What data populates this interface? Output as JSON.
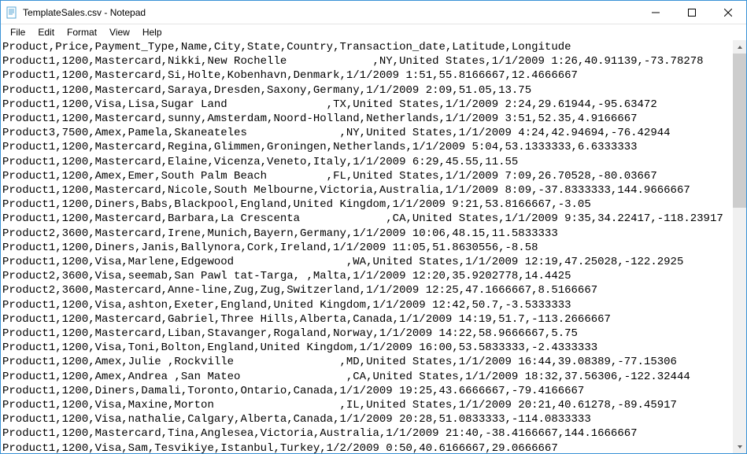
{
  "window": {
    "title": "TemplateSales.csv - Notepad"
  },
  "menu": {
    "file": "File",
    "edit": "Edit",
    "format": "Format",
    "view": "View",
    "help": "Help"
  },
  "content_lines": [
    "Product,Price,Payment_Type,Name,City,State,Country,Transaction_date,Latitude,Longitude",
    "Product1,1200,Mastercard,Nikki,New Rochelle             ,NY,United States,1/1/2009 1:26,40.91139,-73.78278",
    "Product1,1200,Mastercard,Si,Holte,Kobenhavn,Denmark,1/1/2009 1:51,55.8166667,12.4666667",
    "Product1,1200,Mastercard,Saraya,Dresden,Saxony,Germany,1/1/2009 2:09,51.05,13.75",
    "Product1,1200,Visa,Lisa,Sugar Land               ,TX,United States,1/1/2009 2:24,29.61944,-95.63472",
    "Product1,1200,Mastercard,sunny,Amsterdam,Noord-Holland,Netherlands,1/1/2009 3:51,52.35,4.9166667",
    "Product3,7500,Amex,Pamela,Skaneateles              ,NY,United States,1/1/2009 4:24,42.94694,-76.42944",
    "Product1,1200,Mastercard,Regina,Glimmen,Groningen,Netherlands,1/1/2009 5:04,53.1333333,6.6333333",
    "Product1,1200,Mastercard,Elaine,Vicenza,Veneto,Italy,1/1/2009 6:29,45.55,11.55",
    "Product1,1200,Amex,Emer,South Palm Beach         ,FL,United States,1/1/2009 7:09,26.70528,-80.03667",
    "Product1,1200,Mastercard,Nicole,South Melbourne,Victoria,Australia,1/1/2009 8:09,-37.8333333,144.9666667",
    "Product1,1200,Diners,Babs,Blackpool,England,United Kingdom,1/1/2009 9:21,53.8166667,-3.05",
    "Product1,1200,Mastercard,Barbara,La Crescenta             ,CA,United States,1/1/2009 9:35,34.22417,-118.23917",
    "Product2,3600,Mastercard,Irene,Munich,Bayern,Germany,1/1/2009 10:06,48.15,11.5833333",
    "Product1,1200,Diners,Janis,Ballynora,Cork,Ireland,1/1/2009 11:05,51.8630556,-8.58",
    "Product1,1200,Visa,Marlene,Edgewood                 ,WA,United States,1/1/2009 12:19,47.25028,-122.2925",
    "Product2,3600,Visa,seemab,San Pawl tat-Targa, ,Malta,1/1/2009 12:20,35.9202778,14.4425",
    "Product2,3600,Mastercard,Anne-line,Zug,Zug,Switzerland,1/1/2009 12:25,47.1666667,8.5166667",
    "Product1,1200,Visa,ashton,Exeter,England,United Kingdom,1/1/2009 12:42,50.7,-3.5333333",
    "Product1,1200,Mastercard,Gabriel,Three Hills,Alberta,Canada,1/1/2009 14:19,51.7,-113.2666667",
    "Product1,1200,Mastercard,Liban,Stavanger,Rogaland,Norway,1/1/2009 14:22,58.9666667,5.75",
    "Product1,1200,Visa,Toni,Bolton,England,United Kingdom,1/1/2009 16:00,53.5833333,-2.4333333",
    "Product1,1200,Amex,Julie ,Rockville                ,MD,United States,1/1/2009 16:44,39.08389,-77.15306",
    "Product1,1200,Amex,Andrea ,San Mateo                ,CA,United States,1/1/2009 18:32,37.56306,-122.32444",
    "Product1,1200,Diners,Damali,Toronto,Ontario,Canada,1/1/2009 19:25,43.6666667,-79.4166667",
    "Product1,1200,Visa,Maxine,Morton                   ,IL,United States,1/1/2009 20:21,40.61278,-89.45917",
    "Product1,1200,Visa,nathalie,Calgary,Alberta,Canada,1/1/2009 20:28,51.0833333,-114.0833333",
    "Product1,1200,Mastercard,Tina,Anglesea,Victoria,Australia,1/1/2009 21:40,-38.4166667,144.1666667",
    "Product1,1200,Visa,Sam,Tesvikiye,Istanbul,Turkey,1/2/2009 0:50,40.6166667,29.0666667"
  ]
}
